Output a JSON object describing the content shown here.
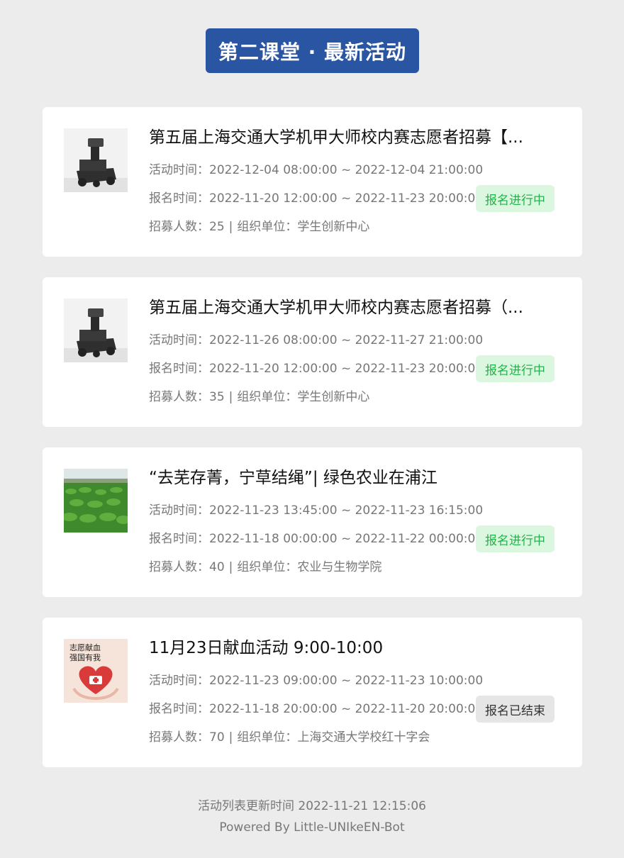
{
  "header": {
    "title": "第二课堂 · 最新活动"
  },
  "labels": {
    "activity_time": "活动时间：",
    "signup_time": "报名时间：",
    "headcount": "招募人数：",
    "organizer": "组织单位：",
    "separator": "|"
  },
  "activities": [
    {
      "title": "第五届上海交通大学机甲大师校内赛志愿者招募【...",
      "activity_time": "2022-12-04 08:00:00 ~ 2022-12-04 21:00:00",
      "signup_time": "2022-11-20 12:00:00 ~ 2022-11-23 20:00:00",
      "headcount": "25",
      "organizer": "学生创新中心",
      "status": "报名进行中",
      "thumbnail_icon": "robot-image"
    },
    {
      "title": "第五届上海交通大学机甲大师校内赛志愿者招募（...",
      "activity_time": "2022-11-26 08:00:00 ~ 2022-11-27 21:00:00",
      "signup_time": "2022-11-20 12:00:00 ~ 2022-11-23 20:00:00",
      "headcount": "35",
      "organizer": "学生创新中心",
      "status": "报名进行中",
      "thumbnail_icon": "robot-image"
    },
    {
      "title": "“去芜存菁，宁草结绳”| 绿色农业在浦江",
      "activity_time": "2022-11-23 13:45:00 ~ 2022-11-23 16:15:00",
      "signup_time": "2022-11-18 00:00:00 ~ 2022-11-22 00:00:00",
      "headcount": "40",
      "organizer": "农业与生物学院",
      "status": "报名进行中",
      "thumbnail_icon": "farm-field-image"
    },
    {
      "title": "11月23日献血活动 9:00-10:00",
      "activity_time": "2022-11-23 09:00:00 ~ 2022-11-23 10:00:00",
      "signup_time": "2022-11-18 20:00:00 ~ 2022-11-20 20:00:00",
      "headcount": "70",
      "organizer": "上海交通大学校红十字会",
      "status": "报名已结束",
      "thumbnail_icon": "blood-donation-poster-image",
      "poster_text": [
        "志愿献血",
        "强国有我"
      ]
    }
  ],
  "footer": {
    "updated": "活动列表更新时间 2022-11-21 12:15:06",
    "powered": "Powered By Little-UNIkeEN-Bot"
  },
  "colors": {
    "header_bg": "#2a55a3",
    "status_open_bg": "#dcf7df",
    "status_open_text": "#22b44a",
    "status_closed_bg": "#e6e6e6",
    "page_bg": "#ececec"
  }
}
